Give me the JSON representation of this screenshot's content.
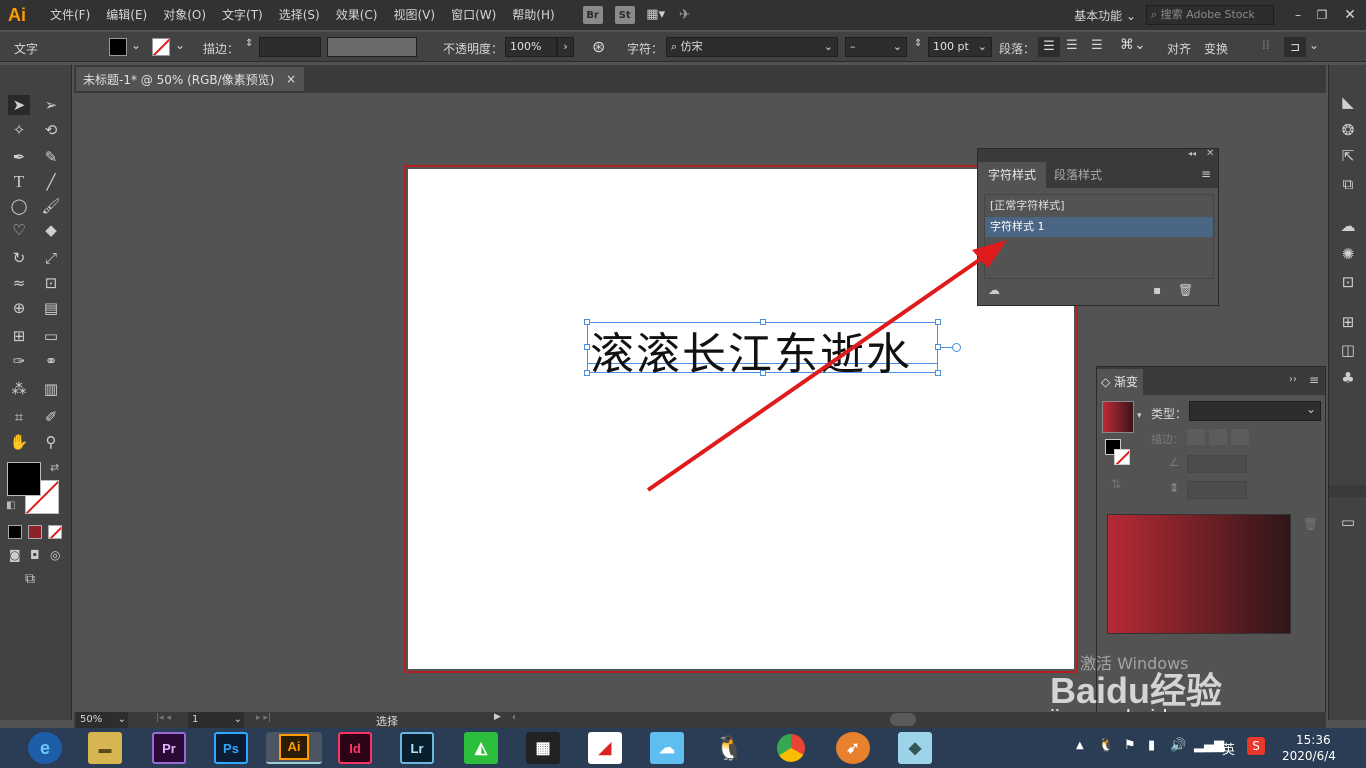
{
  "app": {
    "logo": "Ai"
  },
  "menu": [
    "文件(F)",
    "编辑(E)",
    "对象(O)",
    "文字(T)",
    "选择(S)",
    "效果(C)",
    "视图(V)",
    "窗口(W)",
    "帮助(H)"
  ],
  "bridge_buttons": [
    "Br",
    "St"
  ],
  "workspace": "基本功能",
  "search_placeholder": "搜索 Adobe Stock",
  "control_bar": {
    "type_label": "文字",
    "stroke_label": "描边：",
    "opacity_label": "不透明度：",
    "opacity_value": "100%",
    "char_label": "字符：",
    "font_name": "仿宋",
    "font_style": "–",
    "font_size": "100 pt",
    "para_label": "段落：",
    "align_label": "对齐",
    "transform_label": "变换"
  },
  "document_tab": {
    "title": "未标题-1* @ 50% (RGB/像素预览)",
    "close": "×"
  },
  "canvas_text": "滚滚长江东逝水",
  "char_styles_panel": {
    "tab_active": "字符样式",
    "tab_inactive": "段落样式",
    "items": [
      "[正常字符样式]",
      "字符样式 1"
    ]
  },
  "gradient_panel": {
    "title": "渐变",
    "type_label": "类型：",
    "stroke_label": "描边：",
    "gradient_colors": [
      "#b62a35",
      "#2e1618"
    ]
  },
  "status_bar": {
    "zoom": "50%",
    "page": "1",
    "tool": "选择"
  },
  "taskbar": {
    "apps": [
      "Pr",
      "Ps",
      "Ai",
      "Id",
      "Lr"
    ],
    "time": "15:36",
    "date": "2020/6/4",
    "ime": "英"
  },
  "watermark": {
    "activate": "激活 Windows",
    "site": "jingyan.baidu.com",
    "logo": "Baidu经验"
  },
  "colors": {
    "accent_red": "#e01b1b",
    "ui_dark": "#323232",
    "ui_mid": "#424242",
    "ui_canvas": "#535353"
  }
}
